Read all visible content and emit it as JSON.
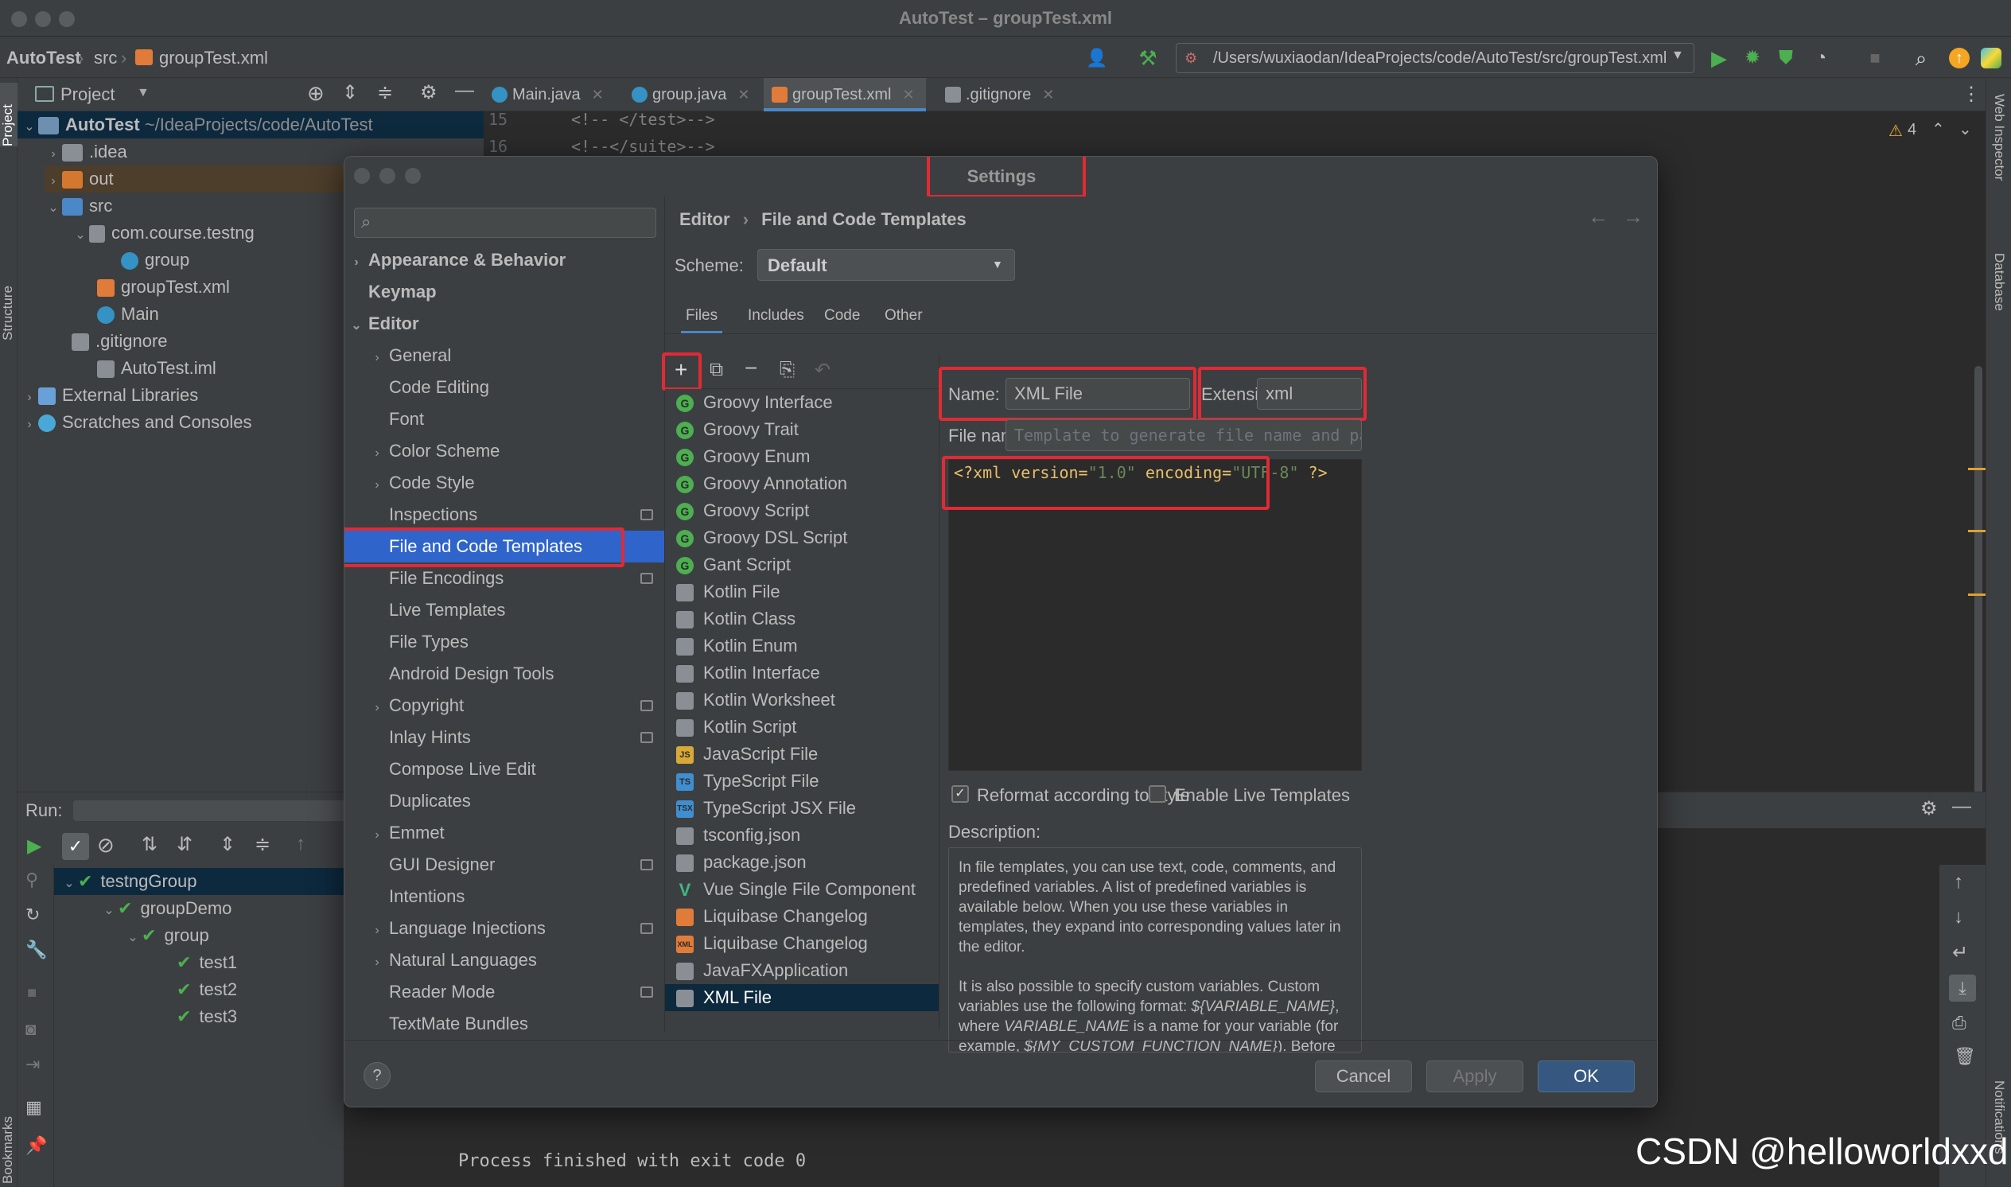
{
  "window": {
    "title": "AutoTest – groupTest.xml"
  },
  "navbar": {
    "crumbs": [
      "AutoTest",
      "src",
      "groupTest.xml"
    ],
    "run_config_path": "/Users/wuxiaodan/IdeaProjects/code/AutoTest/src/groupTest.xml"
  },
  "left_stripe": {
    "project": "Project",
    "structure": "Structure",
    "bookmarks": "Bookmarks"
  },
  "right_stripe": {
    "web_inspector": "Web Inspector",
    "database": "Database",
    "notifications": "Notifications"
  },
  "project_panel": {
    "title": "Project",
    "root": {
      "name": "AutoTest",
      "path": "~/IdeaProjects/code/AutoTest"
    },
    "items": [
      {
        "label": ".idea"
      },
      {
        "label": "out"
      },
      {
        "label": "src"
      },
      {
        "label": "com.course.testng"
      },
      {
        "label": "group"
      },
      {
        "label": "groupTest.xml"
      },
      {
        "label": "Main"
      },
      {
        "label": ".gitignore"
      },
      {
        "label": "AutoTest.iml"
      },
      {
        "label": "External Libraries"
      },
      {
        "label": "Scratches and Consoles"
      }
    ]
  },
  "editor": {
    "tabs": [
      "Main.java",
      "group.java",
      "groupTest.xml",
      ".gitignore"
    ],
    "lines": [
      {
        "num": "15",
        "code": "<!--    </test>-->"
      },
      {
        "num": "16",
        "code": "<!--</suite>-->"
      }
    ],
    "warnings": "4"
  },
  "run_panel": {
    "label": "Run:",
    "tree": [
      {
        "label": "testngGroup"
      },
      {
        "label": "groupDemo"
      },
      {
        "label": "group"
      },
      {
        "label": "test1"
      },
      {
        "label": "test2"
      },
      {
        "label": "test3"
      }
    ],
    "console_output": "Process finished with exit code 0"
  },
  "settings": {
    "title": "Settings",
    "search_placeholder": "",
    "nav": [
      {
        "label": "Appearance & Behavior"
      },
      {
        "label": "Keymap"
      },
      {
        "label": "Editor"
      },
      {
        "label": "General"
      },
      {
        "label": "Code Editing"
      },
      {
        "label": "Font"
      },
      {
        "label": "Color Scheme"
      },
      {
        "label": "Code Style"
      },
      {
        "label": "Inspections"
      },
      {
        "label": "File and Code Templates"
      },
      {
        "label": "File Encodings"
      },
      {
        "label": "Live Templates"
      },
      {
        "label": "File Types"
      },
      {
        "label": "Android Design Tools"
      },
      {
        "label": "Copyright"
      },
      {
        "label": "Inlay Hints"
      },
      {
        "label": "Compose Live Edit"
      },
      {
        "label": "Duplicates"
      },
      {
        "label": "Emmet"
      },
      {
        "label": "GUI Designer"
      },
      {
        "label": "Intentions"
      },
      {
        "label": "Language Injections"
      },
      {
        "label": "Natural Languages"
      },
      {
        "label": "Reader Mode"
      },
      {
        "label": "TextMate Bundles"
      }
    ],
    "breadcrumb": {
      "parent": "Editor",
      "separator": "›",
      "current": "File and Code Templates"
    },
    "scheme": {
      "label": "Scheme:",
      "value": "Default"
    },
    "tabs": [
      "Files",
      "Includes",
      "Code",
      "Other"
    ],
    "templates": [
      {
        "label": "Groovy Interface"
      },
      {
        "label": "Groovy Trait"
      },
      {
        "label": "Groovy Enum"
      },
      {
        "label": "Groovy Annotation"
      },
      {
        "label": "Groovy Script"
      },
      {
        "label": "Groovy DSL Script"
      },
      {
        "label": "Gant Script"
      },
      {
        "label": "Kotlin File"
      },
      {
        "label": "Kotlin Class"
      },
      {
        "label": "Kotlin Enum"
      },
      {
        "label": "Kotlin Interface"
      },
      {
        "label": "Kotlin Worksheet"
      },
      {
        "label": "Kotlin Script"
      },
      {
        "label": "JavaScript File"
      },
      {
        "label": "TypeScript File"
      },
      {
        "label": "TypeScript JSX File"
      },
      {
        "label": "tsconfig.json"
      },
      {
        "label": "package.json"
      },
      {
        "label": "Vue Single File Component"
      },
      {
        "label": "Liquibase Changelog"
      },
      {
        "label": "Liquibase Changelog"
      },
      {
        "label": "JavaFXApplication"
      },
      {
        "label": "XML File"
      }
    ],
    "form": {
      "name_label": "Name:",
      "name_value": "XML File",
      "extension_label": "Extension:",
      "extension_value": "xml",
      "filename_label": "File name:",
      "filename_placeholder": "Template to generate file name and path (optional)",
      "code": {
        "p1": "<?xml version=",
        "v1": "\"1.0\"",
        "p2": " encoding=",
        "v2": "\"UTF-8\"",
        "p3": " ?>"
      },
      "reformat_label": "Reformat according to style",
      "reformat_checked": true,
      "live_templates_label": "Enable Live Templates",
      "live_templates_checked": false,
      "description_label": "Description:",
      "description_p1": "In file templates, you can use text, code, comments, and predefined variables. A list of predefined variables is available below. When you use these variables in templates, they expand into corresponding values later in the editor.",
      "description_p2_a": "It is also possible to specify custom variables. Custom variables use the following format: ",
      "description_p2_b": "${VARIABLE_NAME}",
      "description_p2_c": ", where ",
      "description_p2_d": "VARIABLE_NAME",
      "description_p2_e": " is a name for your variable (for example, ",
      "description_p2_f": "${MY_CUSTOM_FUNCTION_NAME}",
      "description_p2_g": "). Before the IDE creates a new file with custom variables, you see a dialog where you can define values for custom variables in the template."
    },
    "buttons": {
      "help": "?",
      "cancel": "Cancel",
      "apply": "Apply",
      "ok": "OK"
    }
  },
  "watermark": "CSDN @helloworldxxd",
  "colors": {
    "accent": "#2f65ca",
    "highlight_box": "#e02a36",
    "run_green": "#4caf50",
    "xml_string": "#6a8759",
    "xml_tag": "#e8bf6a"
  }
}
